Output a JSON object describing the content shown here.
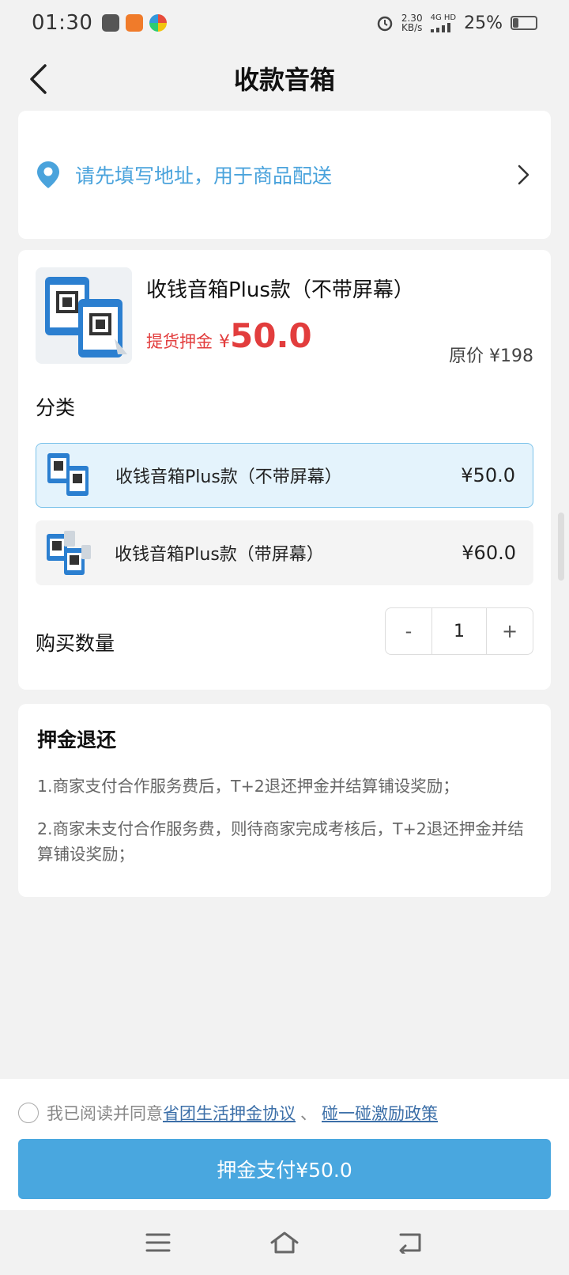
{
  "status_bar": {
    "time": "01:30",
    "net_speed_value": "2.30",
    "net_speed_unit": "KB/s",
    "network_type": "4G HD",
    "battery_text": "25%",
    "battery_level": 0.25
  },
  "header": {
    "title": "收款音箱",
    "back_icon": "chevron-left-icon"
  },
  "address": {
    "prompt": "请先填写地址，用于商品配送",
    "icon": "location-pin-icon",
    "accent_color": "#4aa3dc"
  },
  "product": {
    "name": "收钱音箱Plus款（不带屏幕）",
    "deposit_label": "提货押金",
    "deposit_currency": "¥",
    "deposit_amount": "50.0",
    "original_price": "原价 ¥198",
    "price_color": "#e23d3d"
  },
  "category": {
    "label": "分类",
    "options": [
      {
        "name": "收钱音箱Plus款（不带屏幕）",
        "price": "¥50.0",
        "selected": true
      },
      {
        "name": "收钱音箱Plus款（带屏幕）",
        "price": "¥60.0",
        "selected": false
      }
    ]
  },
  "quantity": {
    "label": "购买数量",
    "minus": "-",
    "value": "1",
    "plus": "+"
  },
  "refund": {
    "title": "押金退还",
    "items": [
      "1.商家支付合作服务费后，T+2退还押金并结算铺设奖励；",
      "2.商家未支付合作服务费，则待商家完成考核后，T+2退还押金并结算铺设奖励；"
    ]
  },
  "agreement": {
    "prefix": "我已阅读并同意",
    "link1": "省团生活押金协议",
    "separator": "、",
    "link2": "碰一碰激励政策",
    "checked": false
  },
  "pay_button": {
    "label": "押金支付¥50.0",
    "color": "#49a7df"
  },
  "system_nav": {
    "icons": [
      "menu-icon",
      "home-icon",
      "back-icon"
    ]
  }
}
